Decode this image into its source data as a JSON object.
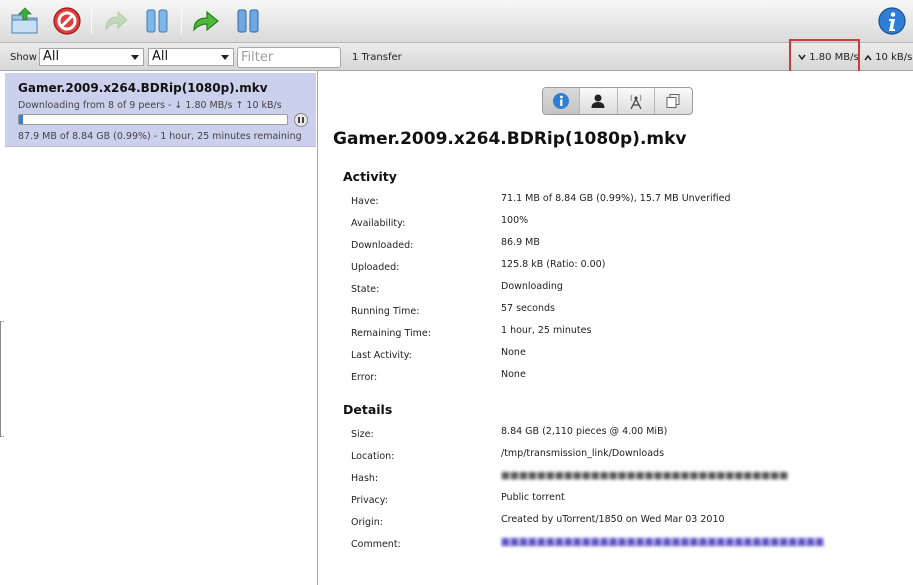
{
  "toolbar": {
    "buttons": [
      {
        "name": "open-torrent-button",
        "icon": "folder-open-icon"
      },
      {
        "name": "remove-torrent-button",
        "icon": "stop-sign-icon"
      },
      {
        "name": "resume-button",
        "icon": "resume-arrow-icon"
      },
      {
        "name": "pause-button",
        "icon": "pause-icon"
      },
      {
        "name": "resume-all-button",
        "icon": "resume-all-arrow-icon"
      },
      {
        "name": "pause-all-button",
        "icon": "pause-all-icon"
      },
      {
        "name": "inspector-toggle-button",
        "icon": "info-icon"
      }
    ]
  },
  "filterbar": {
    "show_label": "Show",
    "status_filter": "All",
    "tracker_filter": "All",
    "filter_placeholder": "Filter",
    "transfer_count": "1 Transfer",
    "download_speed": "1.80 MB/s",
    "upload_speed": "10 kB/s"
  },
  "torrent": {
    "name": "Gamer.2009.x264.BDRip(1080p).mkv",
    "peers": "Downloading from 8 of 9 peers - ↓ 1.80 MB/s ↑ 10 kB/s",
    "progress": 0.0099,
    "status": "87.9 MB of 8.84 GB (0.99%) - 1 hour, 25 minutes remaining"
  },
  "inspector": {
    "tabs": [
      {
        "name": "tab-info",
        "icon": "info-icon"
      },
      {
        "name": "tab-peers",
        "icon": "person-icon"
      },
      {
        "name": "tab-trackers",
        "icon": "antenna-icon"
      },
      {
        "name": "tab-files",
        "icon": "files-icon"
      }
    ],
    "title": "Gamer.2009.x264.BDRip(1080p).mkv",
    "activity": {
      "heading": "Activity",
      "rows": [
        {
          "label": "Have:",
          "value": "71.1 MB of 8.84 GB (0.99%), 15.7 MB Unverified"
        },
        {
          "label": "Availability:",
          "value": "100%"
        },
        {
          "label": "Downloaded:",
          "value": "86.9 MB"
        },
        {
          "label": "Uploaded:",
          "value": "125.8 kB (Ratio: 0.00)"
        },
        {
          "label": "State:",
          "value": "Downloading"
        },
        {
          "label": "Running Time:",
          "value": "57 seconds"
        },
        {
          "label": "Remaining Time:",
          "value": "1 hour, 25 minutes"
        },
        {
          "label": "Last Activity:",
          "value": "None"
        },
        {
          "label": "Error:",
          "value": "None"
        }
      ]
    },
    "details": {
      "heading": "Details",
      "rows": [
        {
          "label": "Size:",
          "value": "8.84 GB (2,110 pieces @ 4.00 MiB)"
        },
        {
          "label": "Location:",
          "value": "/tmp/transmission_link/Downloads"
        },
        {
          "label": "Hash:",
          "value": ""
        },
        {
          "label": "Privacy:",
          "value": "Public torrent"
        },
        {
          "label": "Origin:",
          "value": "Created by uTorrent/1850 on Wed Mar 03 2010"
        },
        {
          "label": "Comment:",
          "value": ""
        }
      ]
    }
  },
  "colors": {
    "selected_row": "#cbd0ed",
    "progress_fill": "#3a7fd0",
    "highlight_box": "#d23a3a"
  }
}
